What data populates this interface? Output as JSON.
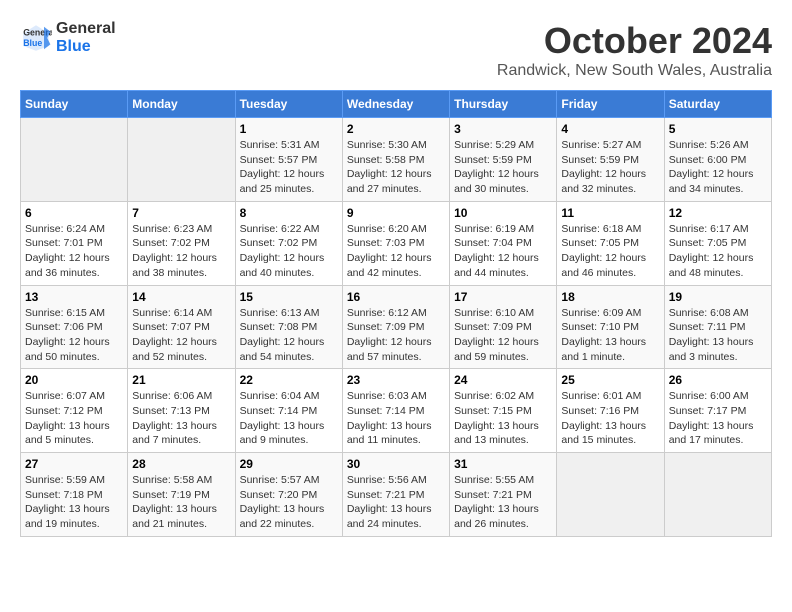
{
  "header": {
    "logo_line1": "General",
    "logo_line2": "Blue",
    "month": "October 2024",
    "location": "Randwick, New South Wales, Australia"
  },
  "weekdays": [
    "Sunday",
    "Monday",
    "Tuesday",
    "Wednesday",
    "Thursday",
    "Friday",
    "Saturday"
  ],
  "weeks": [
    [
      {
        "day": "",
        "info": ""
      },
      {
        "day": "",
        "info": ""
      },
      {
        "day": "1",
        "info": "Sunrise: 5:31 AM\nSunset: 5:57 PM\nDaylight: 12 hours\nand 25 minutes."
      },
      {
        "day": "2",
        "info": "Sunrise: 5:30 AM\nSunset: 5:58 PM\nDaylight: 12 hours\nand 27 minutes."
      },
      {
        "day": "3",
        "info": "Sunrise: 5:29 AM\nSunset: 5:59 PM\nDaylight: 12 hours\nand 30 minutes."
      },
      {
        "day": "4",
        "info": "Sunrise: 5:27 AM\nSunset: 5:59 PM\nDaylight: 12 hours\nand 32 minutes."
      },
      {
        "day": "5",
        "info": "Sunrise: 5:26 AM\nSunset: 6:00 PM\nDaylight: 12 hours\nand 34 minutes."
      }
    ],
    [
      {
        "day": "6",
        "info": "Sunrise: 6:24 AM\nSunset: 7:01 PM\nDaylight: 12 hours\nand 36 minutes."
      },
      {
        "day": "7",
        "info": "Sunrise: 6:23 AM\nSunset: 7:02 PM\nDaylight: 12 hours\nand 38 minutes."
      },
      {
        "day": "8",
        "info": "Sunrise: 6:22 AM\nSunset: 7:02 PM\nDaylight: 12 hours\nand 40 minutes."
      },
      {
        "day": "9",
        "info": "Sunrise: 6:20 AM\nSunset: 7:03 PM\nDaylight: 12 hours\nand 42 minutes."
      },
      {
        "day": "10",
        "info": "Sunrise: 6:19 AM\nSunset: 7:04 PM\nDaylight: 12 hours\nand 44 minutes."
      },
      {
        "day": "11",
        "info": "Sunrise: 6:18 AM\nSunset: 7:05 PM\nDaylight: 12 hours\nand 46 minutes."
      },
      {
        "day": "12",
        "info": "Sunrise: 6:17 AM\nSunset: 7:05 PM\nDaylight: 12 hours\nand 48 minutes."
      }
    ],
    [
      {
        "day": "13",
        "info": "Sunrise: 6:15 AM\nSunset: 7:06 PM\nDaylight: 12 hours\nand 50 minutes."
      },
      {
        "day": "14",
        "info": "Sunrise: 6:14 AM\nSunset: 7:07 PM\nDaylight: 12 hours\nand 52 minutes."
      },
      {
        "day": "15",
        "info": "Sunrise: 6:13 AM\nSunset: 7:08 PM\nDaylight: 12 hours\nand 54 minutes."
      },
      {
        "day": "16",
        "info": "Sunrise: 6:12 AM\nSunset: 7:09 PM\nDaylight: 12 hours\nand 57 minutes."
      },
      {
        "day": "17",
        "info": "Sunrise: 6:10 AM\nSunset: 7:09 PM\nDaylight: 12 hours\nand 59 minutes."
      },
      {
        "day": "18",
        "info": "Sunrise: 6:09 AM\nSunset: 7:10 PM\nDaylight: 13 hours\nand 1 minute."
      },
      {
        "day": "19",
        "info": "Sunrise: 6:08 AM\nSunset: 7:11 PM\nDaylight: 13 hours\nand 3 minutes."
      }
    ],
    [
      {
        "day": "20",
        "info": "Sunrise: 6:07 AM\nSunset: 7:12 PM\nDaylight: 13 hours\nand 5 minutes."
      },
      {
        "day": "21",
        "info": "Sunrise: 6:06 AM\nSunset: 7:13 PM\nDaylight: 13 hours\nand 7 minutes."
      },
      {
        "day": "22",
        "info": "Sunrise: 6:04 AM\nSunset: 7:14 PM\nDaylight: 13 hours\nand 9 minutes."
      },
      {
        "day": "23",
        "info": "Sunrise: 6:03 AM\nSunset: 7:14 PM\nDaylight: 13 hours\nand 11 minutes."
      },
      {
        "day": "24",
        "info": "Sunrise: 6:02 AM\nSunset: 7:15 PM\nDaylight: 13 hours\nand 13 minutes."
      },
      {
        "day": "25",
        "info": "Sunrise: 6:01 AM\nSunset: 7:16 PM\nDaylight: 13 hours\nand 15 minutes."
      },
      {
        "day": "26",
        "info": "Sunrise: 6:00 AM\nSunset: 7:17 PM\nDaylight: 13 hours\nand 17 minutes."
      }
    ],
    [
      {
        "day": "27",
        "info": "Sunrise: 5:59 AM\nSunset: 7:18 PM\nDaylight: 13 hours\nand 19 minutes."
      },
      {
        "day": "28",
        "info": "Sunrise: 5:58 AM\nSunset: 7:19 PM\nDaylight: 13 hours\nand 21 minutes."
      },
      {
        "day": "29",
        "info": "Sunrise: 5:57 AM\nSunset: 7:20 PM\nDaylight: 13 hours\nand 22 minutes."
      },
      {
        "day": "30",
        "info": "Sunrise: 5:56 AM\nSunset: 7:21 PM\nDaylight: 13 hours\nand 24 minutes."
      },
      {
        "day": "31",
        "info": "Sunrise: 5:55 AM\nSunset: 7:21 PM\nDaylight: 13 hours\nand 26 minutes."
      },
      {
        "day": "",
        "info": ""
      },
      {
        "day": "",
        "info": ""
      }
    ]
  ]
}
